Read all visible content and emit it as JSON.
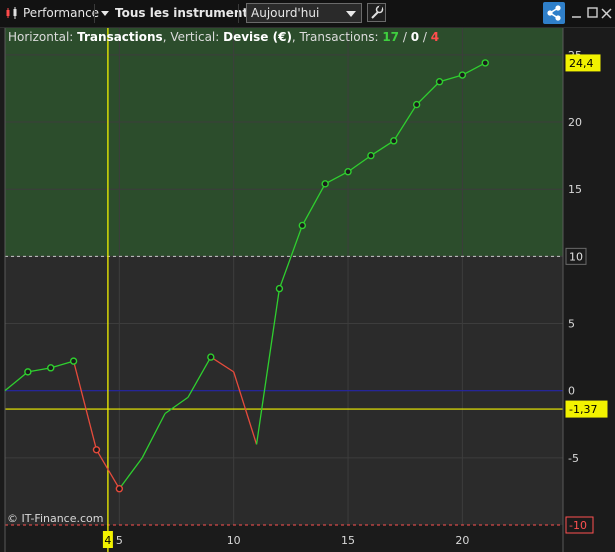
{
  "toolbar": {
    "title": "Performance",
    "filter": "Tous les instruments",
    "period": "Aujourd'hui",
    "colors": {
      "share": "#2f7fc9"
    },
    "icons": [
      "candlestick-icon",
      "chevron-down-icon",
      "wrench-icon",
      "share-icon",
      "minimize-icon",
      "maximize-icon",
      "close-icon"
    ]
  },
  "info": {
    "horizontal_label": "Horizontal: ",
    "horizontal_value": "Transactions",
    "vertical_label": ", Vertical: ",
    "vertical_value": "Devise (€)",
    "transactions_label": ", Transactions: ",
    "count_green": "17",
    "sep1": " / ",
    "count_white": "0",
    "sep2": " / ",
    "count_red": "4"
  },
  "credit": "© IT-Finance.com",
  "chart_data": {
    "type": "line",
    "xlabel": "",
    "ylabel": "",
    "xlim": [
      0,
      24.4
    ],
    "ylim": [
      -10,
      27
    ],
    "x_ticks": [
      5,
      10,
      15,
      20
    ],
    "y_ticks": [
      -5,
      0,
      5,
      10,
      15,
      20,
      25
    ],
    "points": [
      {
        "x": 0,
        "y": 0
      },
      {
        "x": 1,
        "y": 1.4
      },
      {
        "x": 2,
        "y": 1.7
      },
      {
        "x": 3,
        "y": 2.2
      },
      {
        "x": 4,
        "y": -4.4
      },
      {
        "x": 5,
        "y": -7.3
      },
      {
        "x": 6,
        "y": -5.0
      },
      {
        "x": 7,
        "y": -1.7
      },
      {
        "x": 8,
        "y": -0.5
      },
      {
        "x": 9,
        "y": 2.5
      },
      {
        "x": 10,
        "y": 1.4
      },
      {
        "x": 11,
        "y": -4.0
      },
      {
        "x": 12,
        "y": 7.6
      },
      {
        "x": 13,
        "y": 12.3
      },
      {
        "x": 14,
        "y": 15.4
      },
      {
        "x": 15,
        "y": 16.3
      },
      {
        "x": 16,
        "y": 17.5
      },
      {
        "x": 17,
        "y": 18.6
      },
      {
        "x": 18,
        "y": 21.3
      },
      {
        "x": 19,
        "y": 23.0
      },
      {
        "x": 20,
        "y": 23.5
      },
      {
        "x": 21,
        "y": 24.4
      }
    ],
    "marked_points": [
      1,
      2,
      3,
      4,
      5,
      9,
      12,
      13,
      14,
      15,
      16,
      17,
      18,
      19,
      20,
      21
    ],
    "reference_lines": {
      "zero_line": 0,
      "average_line": -1.37,
      "upper_band": 10,
      "lower_band": -10
    },
    "labels": {
      "last_value": "24,4",
      "average_value": "-1,37",
      "upper_band": "10",
      "lower_band": "-10",
      "cursor_x": "4"
    },
    "cursor_x": 4.5,
    "colors": {
      "up": "#2fcf2f",
      "down": "#e64b3c",
      "profit_zone": "#2c4d2c",
      "plot_bg": "#2b2b2b",
      "zero_line": "#2323a6",
      "average_line": "#f2f200",
      "cursor": "#f2f200"
    },
    "grid": true
  }
}
